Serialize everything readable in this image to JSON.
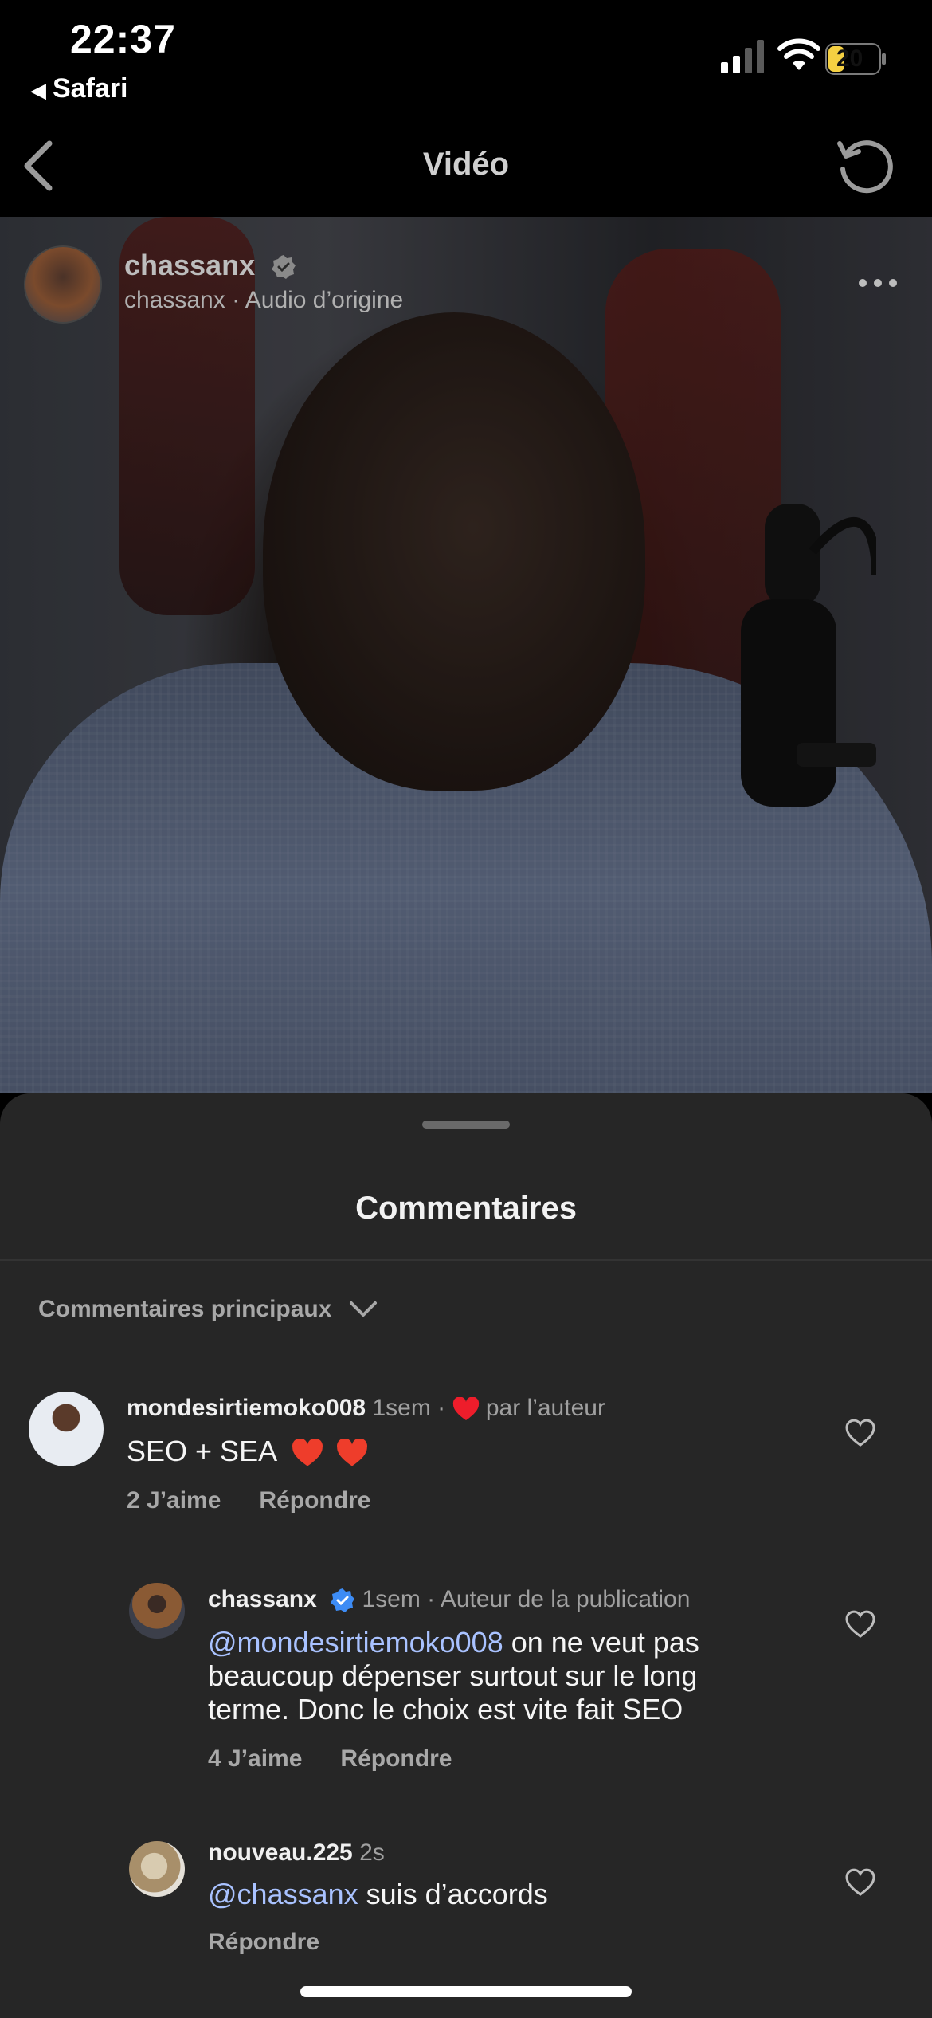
{
  "status_bar": {
    "time": "22:37",
    "back_app": "Safari",
    "battery": "20"
  },
  "nav": {
    "title": "Vidéo"
  },
  "video": {
    "username": "chassanx",
    "subtitle": "chassanx · Audio d’origine"
  },
  "comments_sheet": {
    "title": "Commentaires",
    "sort_label": "Commentaires principaux",
    "comments": [
      {
        "username": "mondesirtiemoko008",
        "time": "1sem",
        "badge": "par l’auteur",
        "text_plain": "SEO + SEA",
        "likes": "2 J’aime",
        "reply": "Répondre"
      },
      {
        "username": "chassanx",
        "time": "1sem",
        "badge": "Auteur de la publication",
        "mention": "@mondesirtiemoko008",
        "text_line1": " on ne veut pas",
        "text_line2": "beaucoup dépenser surtout sur le long",
        "text_line3": "terme. Donc le choix est vite fait SEO",
        "likes": "4 J’aime",
        "reply": "Répondre"
      },
      {
        "username": "nouveau.225",
        "time": "2s",
        "mention": "@chassanx",
        "text_rest": " suis d’accords",
        "reply": "Répondre"
      }
    ]
  },
  "colors": {
    "accent_heart": "#ee1d2b",
    "verified": "#3d8cf5",
    "sheet_bg": "#262626"
  },
  "icons": [
    "back-chevron-icon",
    "refresh-icon",
    "verified-icon",
    "more-icon",
    "chevron-down-icon",
    "heart-icon"
  ]
}
